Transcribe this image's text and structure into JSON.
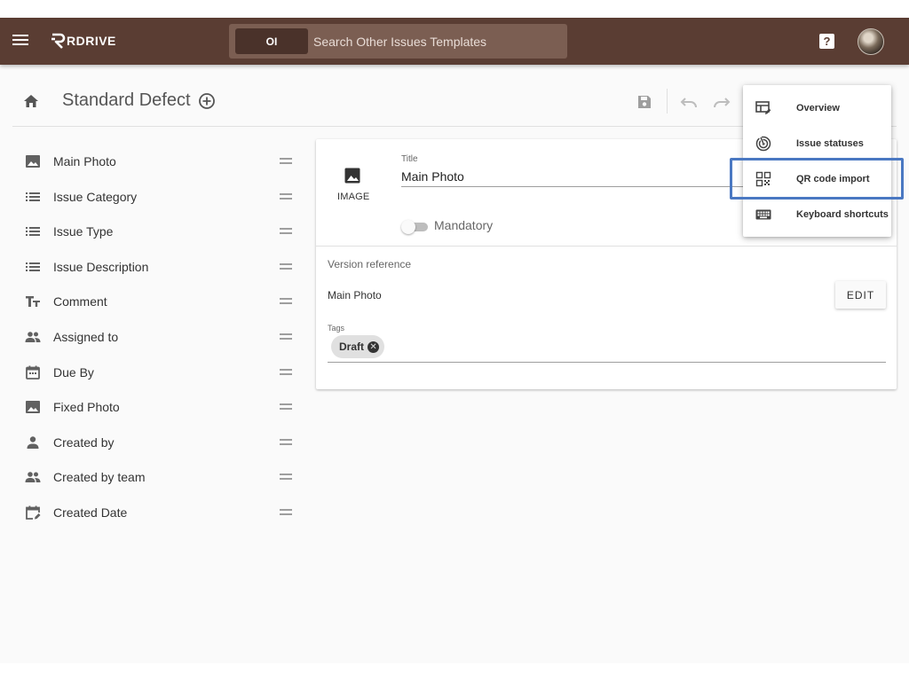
{
  "topbar": {
    "logo_text": "RDRIVE",
    "search_chip": "OI",
    "search_placeholder": "Search Other Issues Templates",
    "help_label": "?"
  },
  "header": {
    "title": "Standard Defect"
  },
  "fields": [
    {
      "label": "Main Photo",
      "icon": "image-icon"
    },
    {
      "label": "Issue Category",
      "icon": "list-icon"
    },
    {
      "label": "Issue Type",
      "icon": "list-icon"
    },
    {
      "label": "Issue Description",
      "icon": "list-icon"
    },
    {
      "label": "Comment",
      "icon": "text-fields-icon"
    },
    {
      "label": "Assigned to",
      "icon": "people-icon"
    },
    {
      "label": "Due By",
      "icon": "calendar-icon"
    },
    {
      "label": "Fixed Photo",
      "icon": "image-icon"
    },
    {
      "label": "Created by",
      "icon": "person-icon"
    },
    {
      "label": "Created by team",
      "icon": "people-icon"
    },
    {
      "label": "Created Date",
      "icon": "calendar-edit-icon"
    }
  ],
  "card": {
    "type_label": "IMAGE",
    "title_caption": "Title",
    "title_value": "Main Photo",
    "mandatory_label": "Mandatory",
    "version_caption": "Version reference",
    "version_value": "Main Photo",
    "edit_label": "EDIT",
    "tags_caption": "Tags",
    "tags": [
      "Draft"
    ]
  },
  "menu": {
    "items": [
      {
        "label": "Overview",
        "icon": "overview-icon"
      },
      {
        "label": "Issue statuses",
        "icon": "radar-icon"
      },
      {
        "label": "QR code import",
        "icon": "qr-code-icon"
      },
      {
        "label": "Keyboard shortcuts",
        "icon": "keyboard-icon"
      }
    ],
    "highlighted": "QR code import"
  },
  "colors": {
    "topbar": "#5a3d33",
    "search_bg": "#7b5e52",
    "highlight": "#4a78c2"
  }
}
